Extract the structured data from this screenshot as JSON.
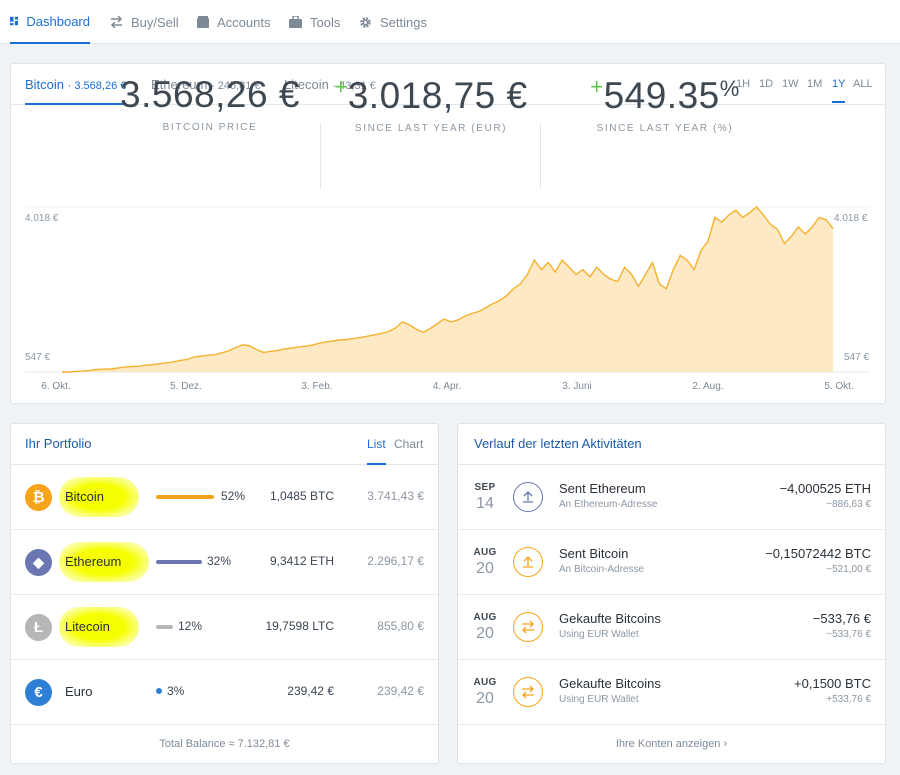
{
  "nav": {
    "items": [
      {
        "label": "Dashboard",
        "icon": "dashboard-icon"
      },
      {
        "label": "Buy/Sell",
        "icon": "exchange-icon"
      },
      {
        "label": "Accounts",
        "icon": "wallet-icon"
      },
      {
        "label": "Tools",
        "icon": "toolbox-icon"
      },
      {
        "label": "Settings",
        "icon": "gear-icon"
      }
    ]
  },
  "price_tabs": [
    {
      "name": "Bitcoin",
      "price": "· 3.568,26 €"
    },
    {
      "name": "Ethereum",
      "price": "· 245,81 €"
    },
    {
      "name": "Litecoin",
      "price": "· 43,31 €"
    }
  ],
  "ranges": [
    "1H",
    "1D",
    "1W",
    "1M",
    "1Y",
    "ALL"
  ],
  "active_range": "1Y",
  "stats": {
    "price": "3.568,26 €",
    "price_caption": "BITCOIN PRICE",
    "change_sign": "+",
    "change": "3.018,75 €",
    "change_caption": "SINCE LAST YEAR (EUR)",
    "pct_sign": "+",
    "pct": "549.35",
    "pct_symbol": "%",
    "pct_caption": "SINCE LAST YEAR (%)"
  },
  "chart_data": {
    "type": "area",
    "title": "",
    "x_ticks": [
      "6. Okt.",
      "5. Dez.",
      "3. Feb.",
      "4. Apr.",
      "3. Juni",
      "2. Aug.",
      "5. Okt."
    ],
    "y_labels": {
      "max": "4.018 €",
      "min": "547 €"
    },
    "ylim": [
      547,
      4018
    ],
    "series": [
      {
        "values": [
          547,
          547,
          560,
          565,
          580,
          600,
          605,
          610,
          630,
          650,
          660,
          670,
          690,
          700,
          720,
          740,
          760,
          790,
          810,
          860,
          880,
          900,
          910,
          950,
          990,
          1060,
          1120,
          1100,
          1020,
          960,
          980,
          1000,
          1030,
          1050,
          1070,
          1090,
          1110,
          1150,
          1180,
          1200,
          1220,
          1230,
          1250,
          1270,
          1300,
          1330,
          1360,
          1400,
          1470,
          1600,
          1540,
          1450,
          1380,
          1460,
          1560,
          1660,
          1600,
          1640,
          1720,
          1780,
          1820,
          1900,
          1980,
          2050,
          2150,
          2300,
          2400,
          2600,
          2900,
          2700,
          2850,
          2650,
          2900,
          2750,
          2600,
          2700,
          2550,
          2750,
          2600,
          2500,
          2450,
          2750,
          2600,
          2350,
          2600,
          2850,
          2400,
          2300,
          2700,
          3000,
          2900,
          2700,
          3100,
          3300,
          3800,
          3700,
          3850,
          3950,
          3800,
          3900,
          4018,
          3850,
          3650,
          3550,
          3250,
          3400,
          3600,
          3450,
          3600,
          3800,
          3750,
          3568
        ]
      }
    ]
  },
  "portfolio": {
    "title": "Ihr Portfolio",
    "view_tabs": [
      "List",
      "Chart"
    ],
    "items": [
      {
        "name": "Bitcoin",
        "symbol": "₿",
        "color": "#f7a21b",
        "pct": "52%",
        "amount": "1,0485 BTC",
        "eur": "3.741,43 €",
        "share": 0.52
      },
      {
        "name": "Ethereum",
        "symbol": "◆",
        "color": "#6b77b1",
        "pct": "32%",
        "amount": "9,3412 ETH",
        "eur": "2.296,17 €",
        "share": 0.32
      },
      {
        "name": "Litecoin",
        "symbol": "Ł",
        "color": "#b6b6b6",
        "pct": "12%",
        "amount": "19,7598 LTC",
        "eur": "855,80 €",
        "share": 0.12
      },
      {
        "name": "Euro",
        "symbol": "€",
        "color": "#2f7fd6",
        "pct": "3%",
        "amount": "239,42 €",
        "eur": "239,42 €",
        "share": 0.03
      }
    ],
    "total": "Total Balance ≈ 7.132,81 €"
  },
  "activity": {
    "title": "Verlauf der letzten Aktivitäten",
    "items": [
      {
        "month": "SEP",
        "day": "14",
        "icon": "send-icon",
        "color": "#6b77b1",
        "title": "Sent Ethereum",
        "sub": "An Ethereum-Adresse",
        "amount": "−4,000525 ETH",
        "eur": "−886,63 €"
      },
      {
        "month": "AUG",
        "day": "20",
        "icon": "send-icon",
        "color": "#f7a21b",
        "title": "Sent Bitcoin",
        "sub": "An Bitcoin-Adresse",
        "amount": "−0,15072442 BTC",
        "eur": "−521,00 €"
      },
      {
        "month": "AUG",
        "day": "20",
        "icon": "exchange-icon",
        "color": "#f7a21b",
        "title": "Gekaufte Bitcoins",
        "sub": "Using EUR Wallet",
        "amount": "−533,76 €",
        "eur": "−533,76 €"
      },
      {
        "month": "AUG",
        "day": "20",
        "icon": "exchange-icon",
        "color": "#f7a21b",
        "title": "Gekaufte Bitcoins",
        "sub": "Using EUR Wallet",
        "amount": "+0,1500 BTC",
        "eur": "+533,76 €"
      }
    ],
    "footer": "Ihre Konten anzeigen ›"
  }
}
